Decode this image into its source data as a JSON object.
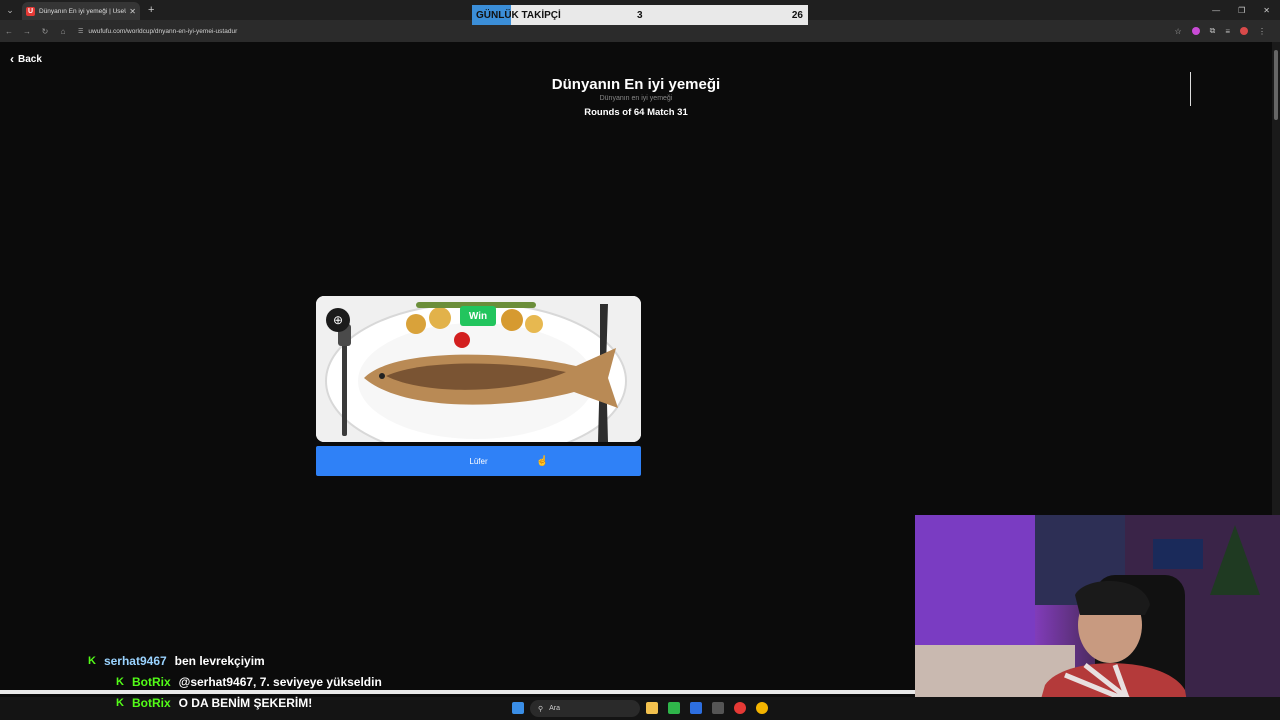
{
  "browser": {
    "tab_title": "Dünyanın En iyi yemeği | UseU",
    "tab_favicon_letter": "U",
    "url": "uwufufu.com/worldcup/dnyann-en-iyi-yemei-ustadur",
    "new_tab_label": "+",
    "close_label": "✕"
  },
  "overlay": {
    "followers_label": "GÜNLÜK TAKİPÇİ",
    "followers_current": "3",
    "followers_goal": "26",
    "followers_progress": 0.115,
    "accent_color": "#3b8ed8"
  },
  "page": {
    "back_label": "Back",
    "title": "Dünyanın En iyi yemeği",
    "subtitle": "Dünyanın en iyi yemeği",
    "round": "Rounds of 64 Match 31",
    "card": {
      "badge": "Win",
      "badge_color": "#22c55e",
      "choice_label": "Lüfer",
      "choice_color": "#2f81f7",
      "zoom_icon": "zoom-in-icon"
    }
  },
  "chat": [
    {
      "user": "serhat9467",
      "message": "ben levrekçiyim"
    },
    {
      "user": "BotRix",
      "message": "@serhat9467, 7. seviyeye yükseldin"
    },
    {
      "user": "BotRix",
      "message": "O DA BENİM ŞEKERİM!"
    }
  ],
  "taskbar": {
    "search_label": "Ara"
  }
}
